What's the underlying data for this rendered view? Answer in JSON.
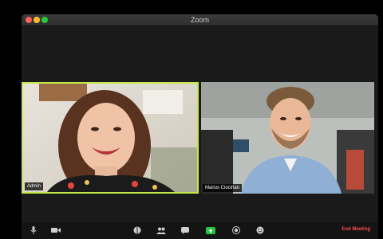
{
  "window": {
    "title": "Zoom"
  },
  "participants": [
    {
      "name": "Admin"
    },
    {
      "name": "Marius Ciocirlan"
    }
  ],
  "toolbar": {
    "end_label": "End Meeting",
    "icons": [
      "microphone-icon",
      "video-icon",
      "security-icon",
      "participants-icon",
      "chat-icon",
      "share-screen-icon",
      "record-icon",
      "reactions-icon"
    ]
  },
  "colors": {
    "active_speaker_border": "#c6e94a",
    "end_meeting": "#ff4d4d",
    "share_screen": "#25c442"
  }
}
